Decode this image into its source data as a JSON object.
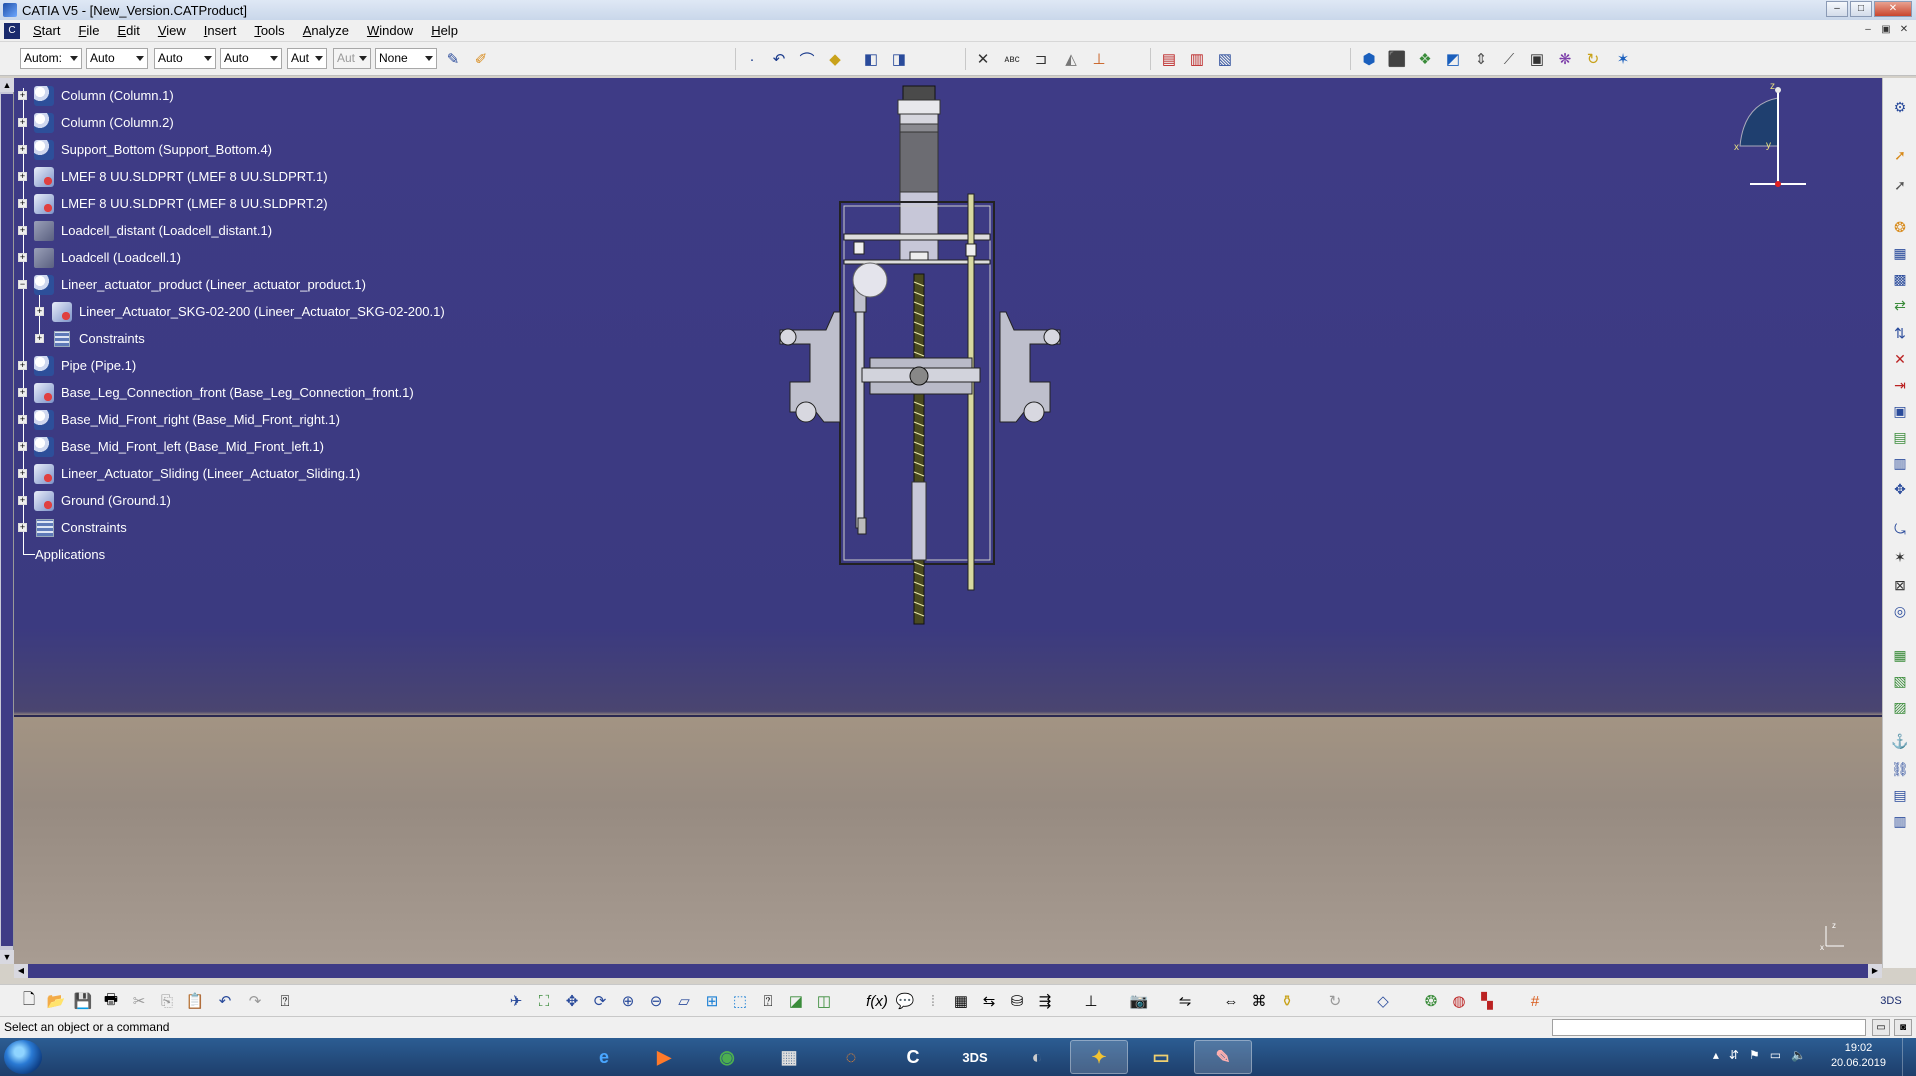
{
  "window": {
    "title": "CATIA V5 - [New_Version.CATProduct]",
    "buttons": {
      "minimize": "–",
      "maximize": "□",
      "close": "✕"
    }
  },
  "menu": {
    "items": [
      "Start",
      "File",
      "Edit",
      "View",
      "Insert",
      "Tools",
      "Analyze",
      "Window",
      "Help"
    ],
    "mdi": {
      "minimize": "–",
      "restore": "▣",
      "close": "✕"
    }
  },
  "toolbar_top": {
    "combos": [
      "Autom:",
      "Auto",
      "Auto",
      "Auto",
      "Aut",
      "Aut",
      "None"
    ]
  },
  "tree": {
    "items": [
      {
        "label": "Column (Column.1)"
      },
      {
        "label": "Column (Column.2)"
      },
      {
        "label": "Support_Bottom (Support_Bottom.4)"
      },
      {
        "label": "LMEF 8 UU.SLDPRT (LMEF 8 UU.SLDPRT.1)"
      },
      {
        "label": "LMEF 8 UU.SLDPRT (LMEF 8 UU.SLDPRT.2)"
      },
      {
        "label": "Loadcell_distant (Loadcell_distant.1)"
      },
      {
        "label": "Loadcell (Loadcell.1)"
      },
      {
        "label": "Lineer_actuator_product (Lineer_actuator_product.1)"
      },
      {
        "label": "Lineer_Actuator_SKG-02-200 (Lineer_Actuator_SKG-02-200.1)"
      },
      {
        "label": "Constraints"
      },
      {
        "label": "Pipe (Pipe.1)"
      },
      {
        "label": "Base_Leg_Connection_front (Base_Leg_Connection_front.1)"
      },
      {
        "label": "Base_Mid_Front_right (Base_Mid_Front_right.1)"
      },
      {
        "label": "Base_Mid_Front_left (Base_Mid_Front_left.1)"
      },
      {
        "label": "Lineer_Actuator_Sliding (Lineer_Actuator_Sliding.1)"
      },
      {
        "label": "Ground (Ground.1)"
      },
      {
        "label": "Constraints"
      },
      {
        "label": "Applications"
      }
    ]
  },
  "compass": {
    "x_label": "x",
    "y_label": "y",
    "z_label": "z"
  },
  "axis_mini": {
    "x_label": "x",
    "z_label": "z"
  },
  "status": {
    "message": "Select an object or a command"
  },
  "taskbar": {
    "time": "19:02",
    "date": "20.06.2019"
  },
  "colors": {
    "viewport_sky": "#3e3b86",
    "viewport_ground": "#a39483",
    "tree_text": "#ffffff"
  }
}
